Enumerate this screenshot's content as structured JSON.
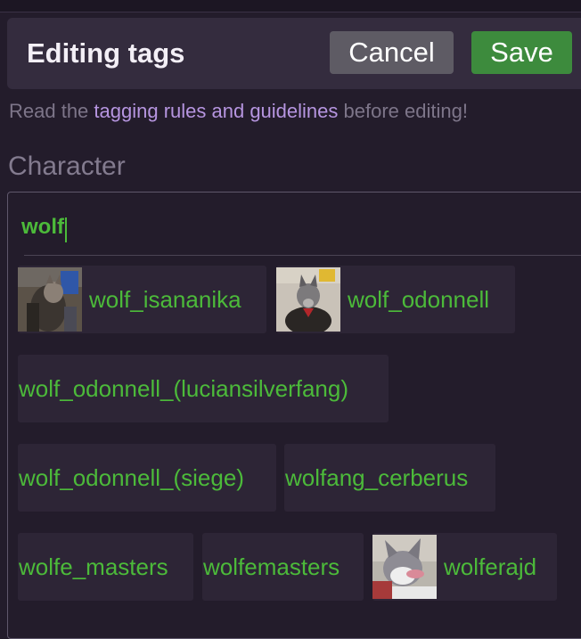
{
  "header": {
    "title": "Editing tags",
    "cancel_label": "Cancel",
    "save_label": "Save"
  },
  "guidelines": {
    "prefix": "Read the",
    "link_text": "tagging rules and guidelines",
    "suffix": "before editing!"
  },
  "section": {
    "label": "Character"
  },
  "search": {
    "value": "wolf"
  },
  "suggestions": [
    {
      "label": "wolf_isananika",
      "has_thumb": true
    },
    {
      "label": "wolf_odonnell",
      "has_thumb": true
    },
    {
      "label": "wolf_odonnell_(luciansilverfang)",
      "has_thumb": false
    },
    {
      "label": "wolf_odonnell_(siege)",
      "has_thumb": false
    },
    {
      "label": "wolfang_cerberus",
      "has_thumb": false
    },
    {
      "label": "wolfe_masters",
      "has_thumb": false
    },
    {
      "label": "wolfemasters",
      "has_thumb": false
    },
    {
      "label": "wolferajd",
      "has_thumb": true
    }
  ],
  "colors": {
    "background": "#231c2b",
    "header_bg": "#342c3e",
    "cancel_bg": "#5e5b64",
    "save_bg": "#3d8b3d",
    "tag_text": "#4cba3a",
    "link": "#b695e0",
    "chip_bg": "#2d2536"
  }
}
